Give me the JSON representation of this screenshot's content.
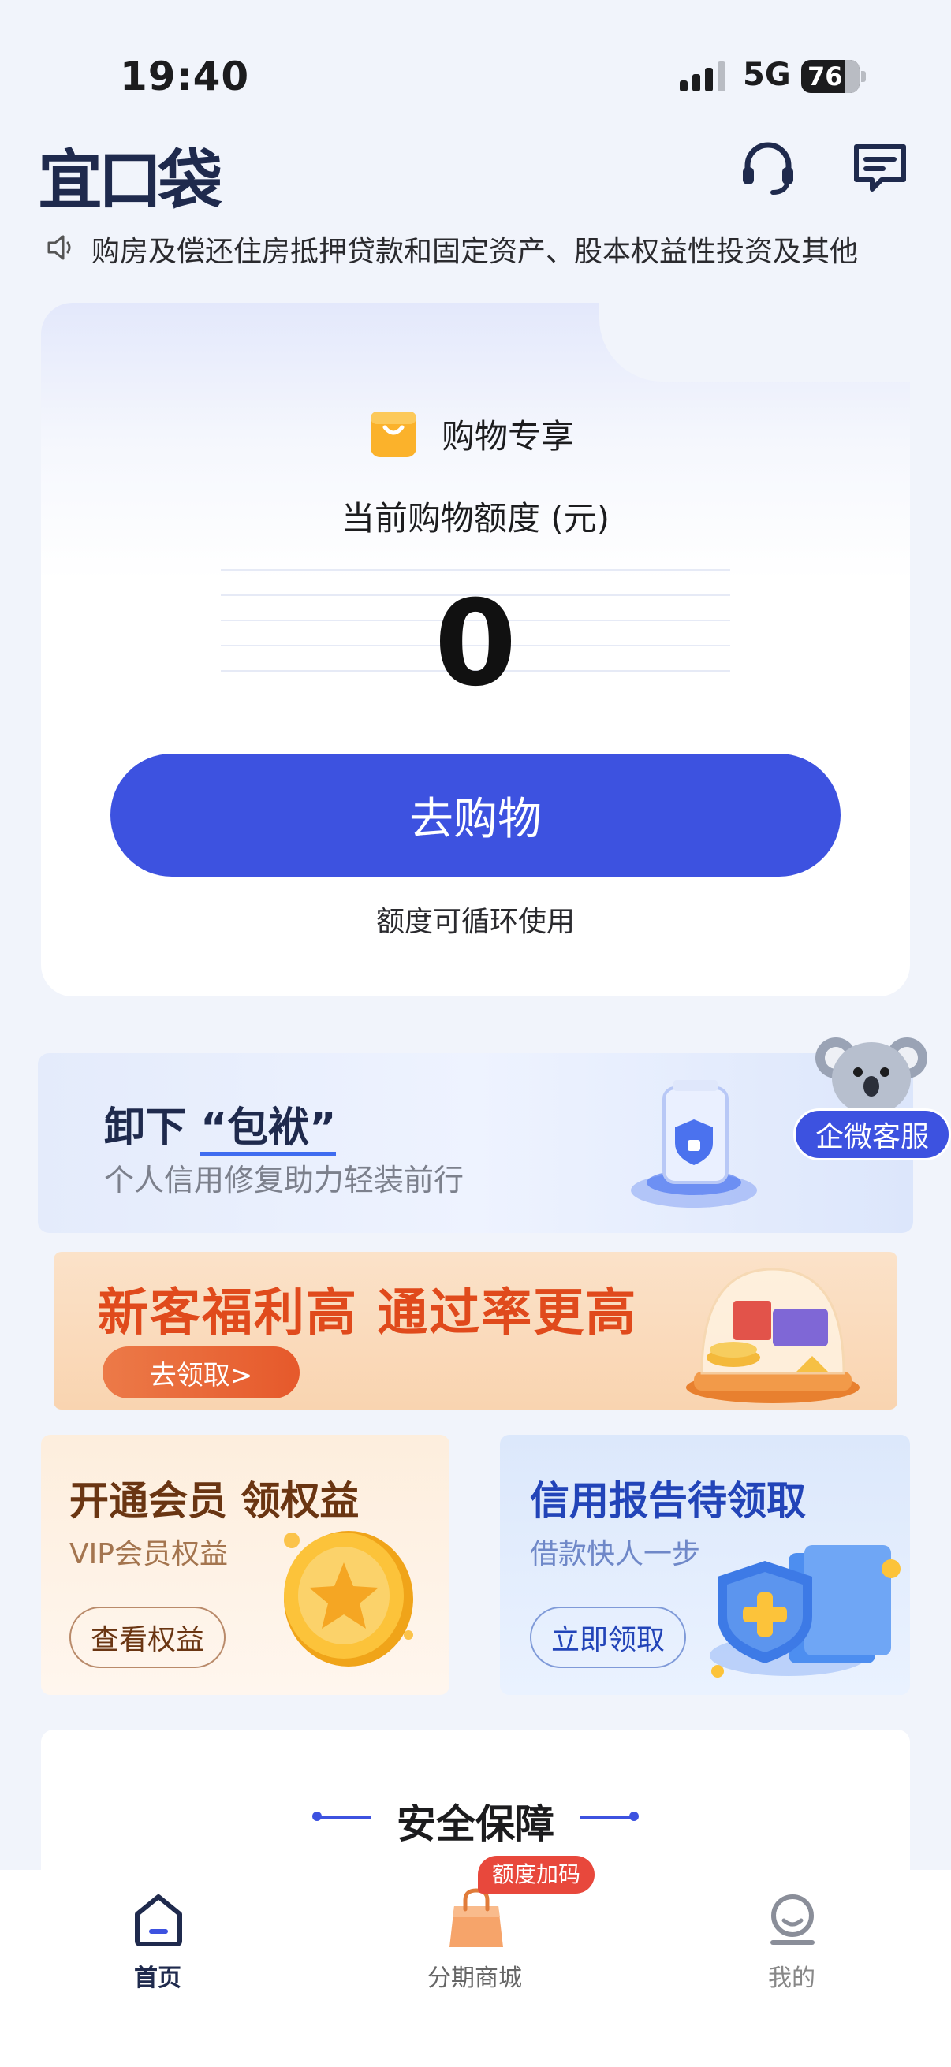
{
  "status_bar": {
    "time": "19:40",
    "network": "5G",
    "battery": "76"
  },
  "header": {
    "logo": "宜口袋",
    "support_icon": "headset-icon",
    "message_icon": "message-icon"
  },
  "notice": {
    "text": "购房及偿还住房抵押贷款和固定资产、股本权益性投资及其他"
  },
  "main_card": {
    "category": "购物专享",
    "limit_label": "当前购物额度 (元)",
    "amount": "0",
    "cta": "去购物",
    "note": "额度可循环使用"
  },
  "banner_credit_repair": {
    "title_prefix": "卸下",
    "title_highlight": "“包袱”",
    "subtitle": "个人信用修复助力轻装前行"
  },
  "service": {
    "label": "企微客服"
  },
  "banner_new_user": {
    "title": "新客福利高 通过率更高",
    "button": "去领取>"
  },
  "vip_card": {
    "title": "开通会员 领权益",
    "subtitle": "VIP会员权益",
    "button": "查看权益"
  },
  "credit_card": {
    "title": "信用报告待领取",
    "subtitle": "借款快人一步",
    "button": "立即领取"
  },
  "safety": {
    "title": "安全保障"
  },
  "tabbar": {
    "items": [
      {
        "label": "首页",
        "icon": "home-icon",
        "active": true
      },
      {
        "label": "分期商城",
        "icon": "shopping-bag-icon",
        "active": false
      },
      {
        "label": "我的",
        "icon": "profile-icon",
        "active": false
      }
    ],
    "mall_badge": "额度加码"
  },
  "colors": {
    "primary": "#3d52e0",
    "background": "#f1f4fb",
    "accent_orange": "#e04a1c"
  }
}
